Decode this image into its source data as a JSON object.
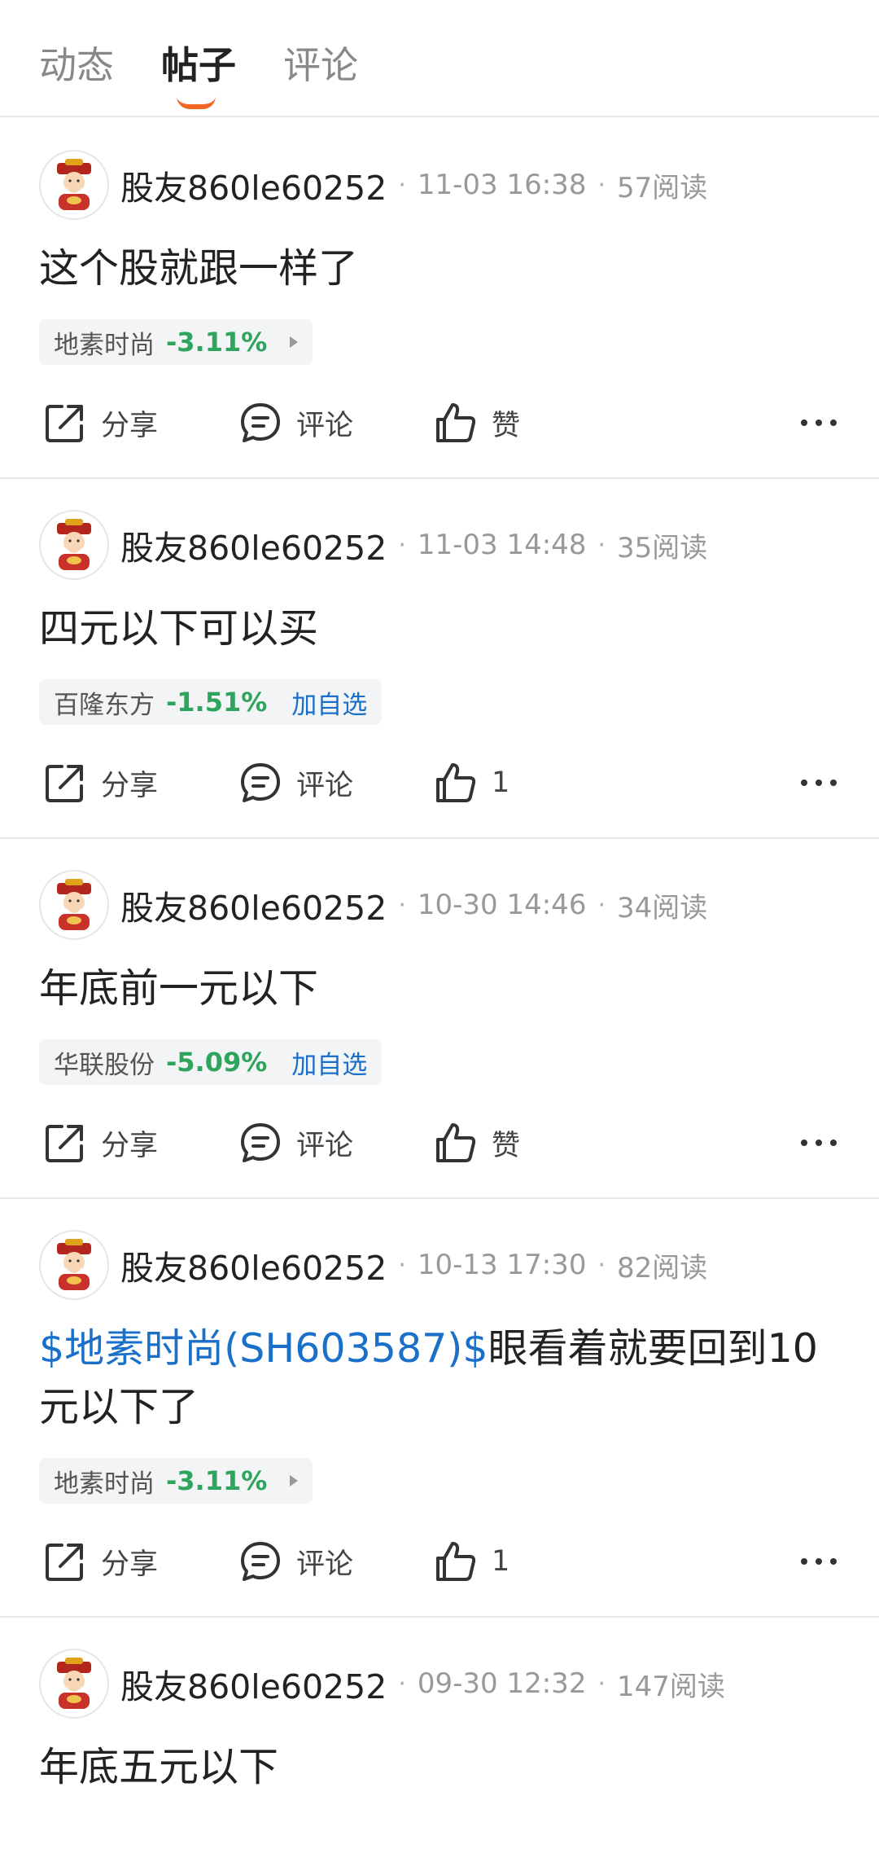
{
  "tabs": [
    {
      "label": "动态",
      "active": false
    },
    {
      "label": "帖子",
      "active": true
    },
    {
      "label": "评论",
      "active": false
    }
  ],
  "actions": {
    "share": "分享",
    "comment": "评论"
  },
  "posts": [
    {
      "username": "股友860le60252",
      "time": "11-03 16:38",
      "reads": "57阅读",
      "body_link": "",
      "body_text": "这个股就跟一样了",
      "stock": {
        "name": "地素时尚",
        "change": "-3.11%",
        "add": ""
      },
      "like": "赞"
    },
    {
      "username": "股友860le60252",
      "time": "11-03 14:48",
      "reads": "35阅读",
      "body_link": "",
      "body_text": "四元以下可以买",
      "stock": {
        "name": "百隆东方",
        "change": "-1.51%",
        "add": "加自选"
      },
      "like": "1"
    },
    {
      "username": "股友860le60252",
      "time": "10-30 14:46",
      "reads": "34阅读",
      "body_link": "",
      "body_text": "年底前一元以下",
      "stock": {
        "name": "华联股份",
        "change": "-5.09%",
        "add": "加自选"
      },
      "like": "赞"
    },
    {
      "username": "股友860le60252",
      "time": "10-13 17:30",
      "reads": "82阅读",
      "body_link": "$地素时尚(SH603587)$",
      "body_text": "眼看着就要回到10元以下了",
      "stock": {
        "name": "地素时尚",
        "change": "-3.11%",
        "add": ""
      },
      "like": "1"
    },
    {
      "username": "股友860le60252",
      "time": "09-30 12:32",
      "reads": "147阅读",
      "body_link": "",
      "body_text": "年底五元以下",
      "stock": null,
      "like": ""
    }
  ]
}
